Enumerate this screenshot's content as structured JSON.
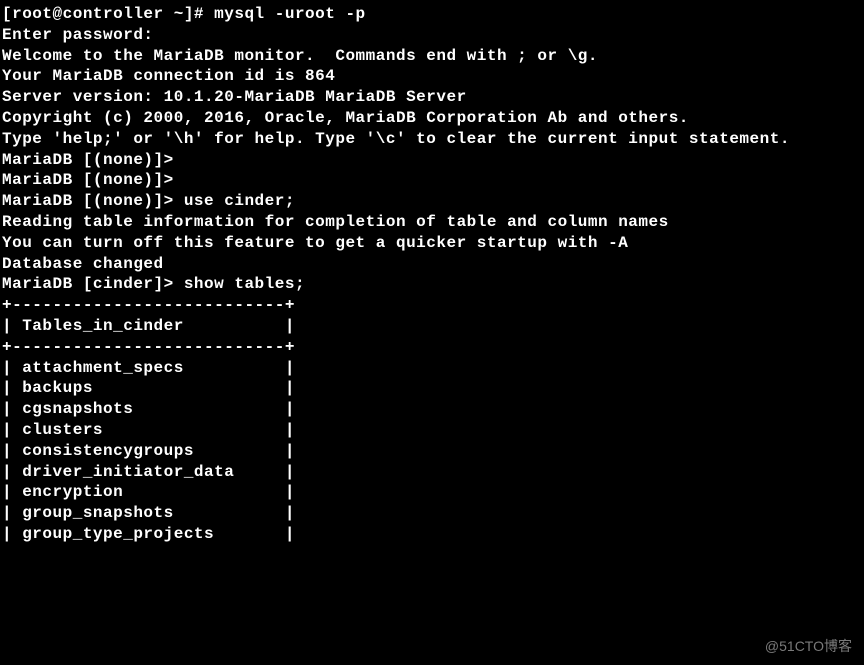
{
  "prompt_line": "[root@controller ~]# mysql -uroot -p",
  "enter_password": "Enter password:",
  "welcome": "Welcome to the MariaDB monitor.  Commands end with ; or \\g.",
  "conn_id": "Your MariaDB connection id is 864",
  "server_ver": "Server version: 10.1.20-MariaDB MariaDB Server",
  "blank": "",
  "copyright": "Copyright (c) 2000, 2016, Oracle, MariaDB Corporation Ab and others.",
  "help": "Type 'help;' or '\\h' for help. Type '\\c' to clear the current input statement.",
  "none1": "MariaDB [(none)]>",
  "none2": "MariaDB [(none)]>",
  "use_cinder": "MariaDB [(none)]> use cinder;",
  "reading": "Reading table information for completion of table and column names",
  "turn_off": "You can turn off this feature to get a quicker startup with -A",
  "db_changed": "Database changed",
  "show_tables": "MariaDB [cinder]> show tables;",
  "sep": "+---------------------------+",
  "header": "| Tables_in_cinder          |",
  "row0": "| attachment_specs          |",
  "row1": "| backups                   |",
  "row2": "| cgsnapshots               |",
  "row3": "| clusters                  |",
  "row4": "| consistencygroups         |",
  "row5": "| driver_initiator_data     |",
  "row6": "| encryption                |",
  "row7": "| group_snapshots           |",
  "row8": "| group_type_projects       |",
  "watermark": "@51CTO博客",
  "chart_data": {
    "type": "table",
    "title": "Tables_in_cinder",
    "columns": [
      "Tables_in_cinder"
    ],
    "rows": [
      [
        "attachment_specs"
      ],
      [
        "backups"
      ],
      [
        "cgsnapshots"
      ],
      [
        "clusters"
      ],
      [
        "consistencygroups"
      ],
      [
        "driver_initiator_data"
      ],
      [
        "encryption"
      ],
      [
        "group_snapshots"
      ],
      [
        "group_type_projects"
      ]
    ]
  }
}
